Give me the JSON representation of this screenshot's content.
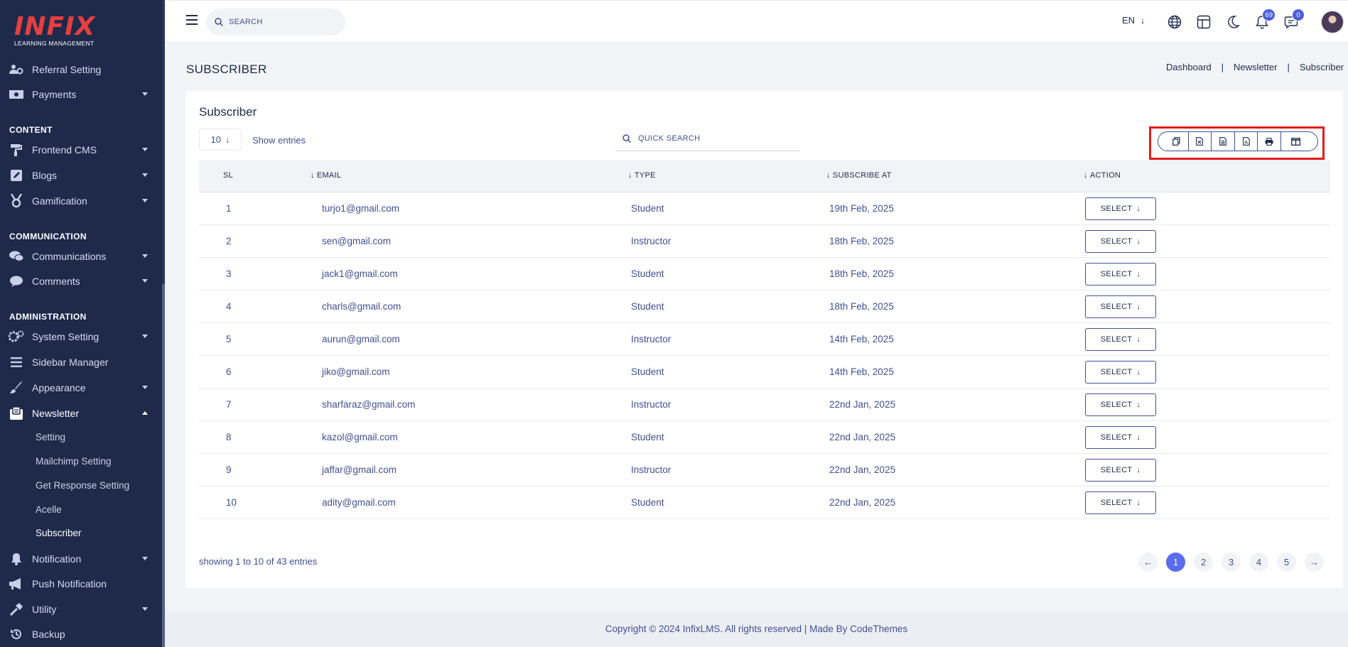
{
  "brand": {
    "logo_text": "INFIX",
    "logo_subtitle": "LEARNING MANAGEMENT"
  },
  "sidebar": {
    "items_top": [
      {
        "label": "Referral Setting",
        "icon": "users-cog-icon",
        "has_caret": false
      },
      {
        "label": "Payments",
        "icon": "money-icon",
        "has_caret": true
      }
    ],
    "section_content": "CONTENT",
    "items_content": [
      {
        "label": "Frontend CMS",
        "icon": "paint-roller-icon"
      },
      {
        "label": "Blogs",
        "icon": "edit-icon"
      },
      {
        "label": "Gamification",
        "icon": "medal-icon"
      }
    ],
    "section_communication": "COMMUNICATION",
    "items_communication": [
      {
        "label": "Communications",
        "icon": "chat-bubbles-icon"
      },
      {
        "label": "Comments",
        "icon": "comment-icon"
      }
    ],
    "section_administration": "ADMINISTRATION",
    "items_admin": [
      {
        "label": "System Setting",
        "icon": "gears-icon"
      },
      {
        "label": "Sidebar Manager",
        "icon": "bars-icon"
      },
      {
        "label": "Appearance",
        "icon": "brush-icon"
      },
      {
        "label": "Newsletter",
        "icon": "newsletter-icon"
      }
    ],
    "newsletter_sub": [
      "Setting",
      "Mailchimp Setting",
      "Get Response Setting",
      "Acelle",
      "Subscriber"
    ],
    "items_bottom": [
      {
        "label": "Notification",
        "icon": "bell-icon"
      },
      {
        "label": "Push Notification",
        "icon": "bullhorn-icon"
      },
      {
        "label": "Utility",
        "icon": "hammer-icon"
      },
      {
        "label": "Backup",
        "icon": "history-icon"
      }
    ]
  },
  "topbar": {
    "search_placeholder": "SEARCH",
    "language": "EN",
    "notification_count": "69",
    "message_count": "0"
  },
  "page": {
    "title": "SUBSCRIBER",
    "breadcrumb": [
      "Dashboard",
      "Newsletter",
      "Subscriber"
    ]
  },
  "card": {
    "title": "Subscriber",
    "entries_value": "10",
    "show_entries_label": "Show entries",
    "quick_search_placeholder": "QUICK SEARCH"
  },
  "table": {
    "columns": [
      "SL",
      "EMAIL",
      "TYPE",
      "SUBSCRIBE AT",
      "ACTION"
    ],
    "action_label": "SELECT",
    "rows": [
      {
        "sl": "1",
        "email": "turjo1@gmail.com",
        "type": "Student",
        "date": "19th Feb, 2025"
      },
      {
        "sl": "2",
        "email": "sen@gmail.com",
        "type": "Instructor",
        "date": "18th Feb, 2025"
      },
      {
        "sl": "3",
        "email": "jack1@gmail.com",
        "type": "Student",
        "date": "18th Feb, 2025"
      },
      {
        "sl": "4",
        "email": "charls@gmail.com",
        "type": "Student",
        "date": "18th Feb, 2025"
      },
      {
        "sl": "5",
        "email": "aurun@gmail.com",
        "type": "Instructor",
        "date": "14th Feb, 2025"
      },
      {
        "sl": "6",
        "email": "jiko@gmail.com",
        "type": "Student",
        "date": "14th Feb, 2025"
      },
      {
        "sl": "7",
        "email": "sharfaraz@gmail.com",
        "type": "Instructor",
        "date": "22nd Jan, 2025"
      },
      {
        "sl": "8",
        "email": "kazol@gmail.com",
        "type": "Student",
        "date": "22nd Jan, 2025"
      },
      {
        "sl": "9",
        "email": "jaffar@gmail.com",
        "type": "Instructor",
        "date": "22nd Jan, 2025"
      },
      {
        "sl": "10",
        "email": "adity@gmail.com",
        "type": "Student",
        "date": "22nd Jan, 2025"
      }
    ]
  },
  "pagination": {
    "showing": "showing 1 to 10 of 43 entries",
    "pages": [
      "1",
      "2",
      "3",
      "4",
      "5"
    ],
    "active_page": "1"
  },
  "footer": {
    "text": "Copyright © 2024 InfixLMS. All rights reserved | Made By CodeThemes"
  },
  "colors": {
    "sidebar_bg": "#1f2a4b",
    "accent": "#5a6bec",
    "text": "#415094",
    "highlight": "#e61a1a"
  }
}
